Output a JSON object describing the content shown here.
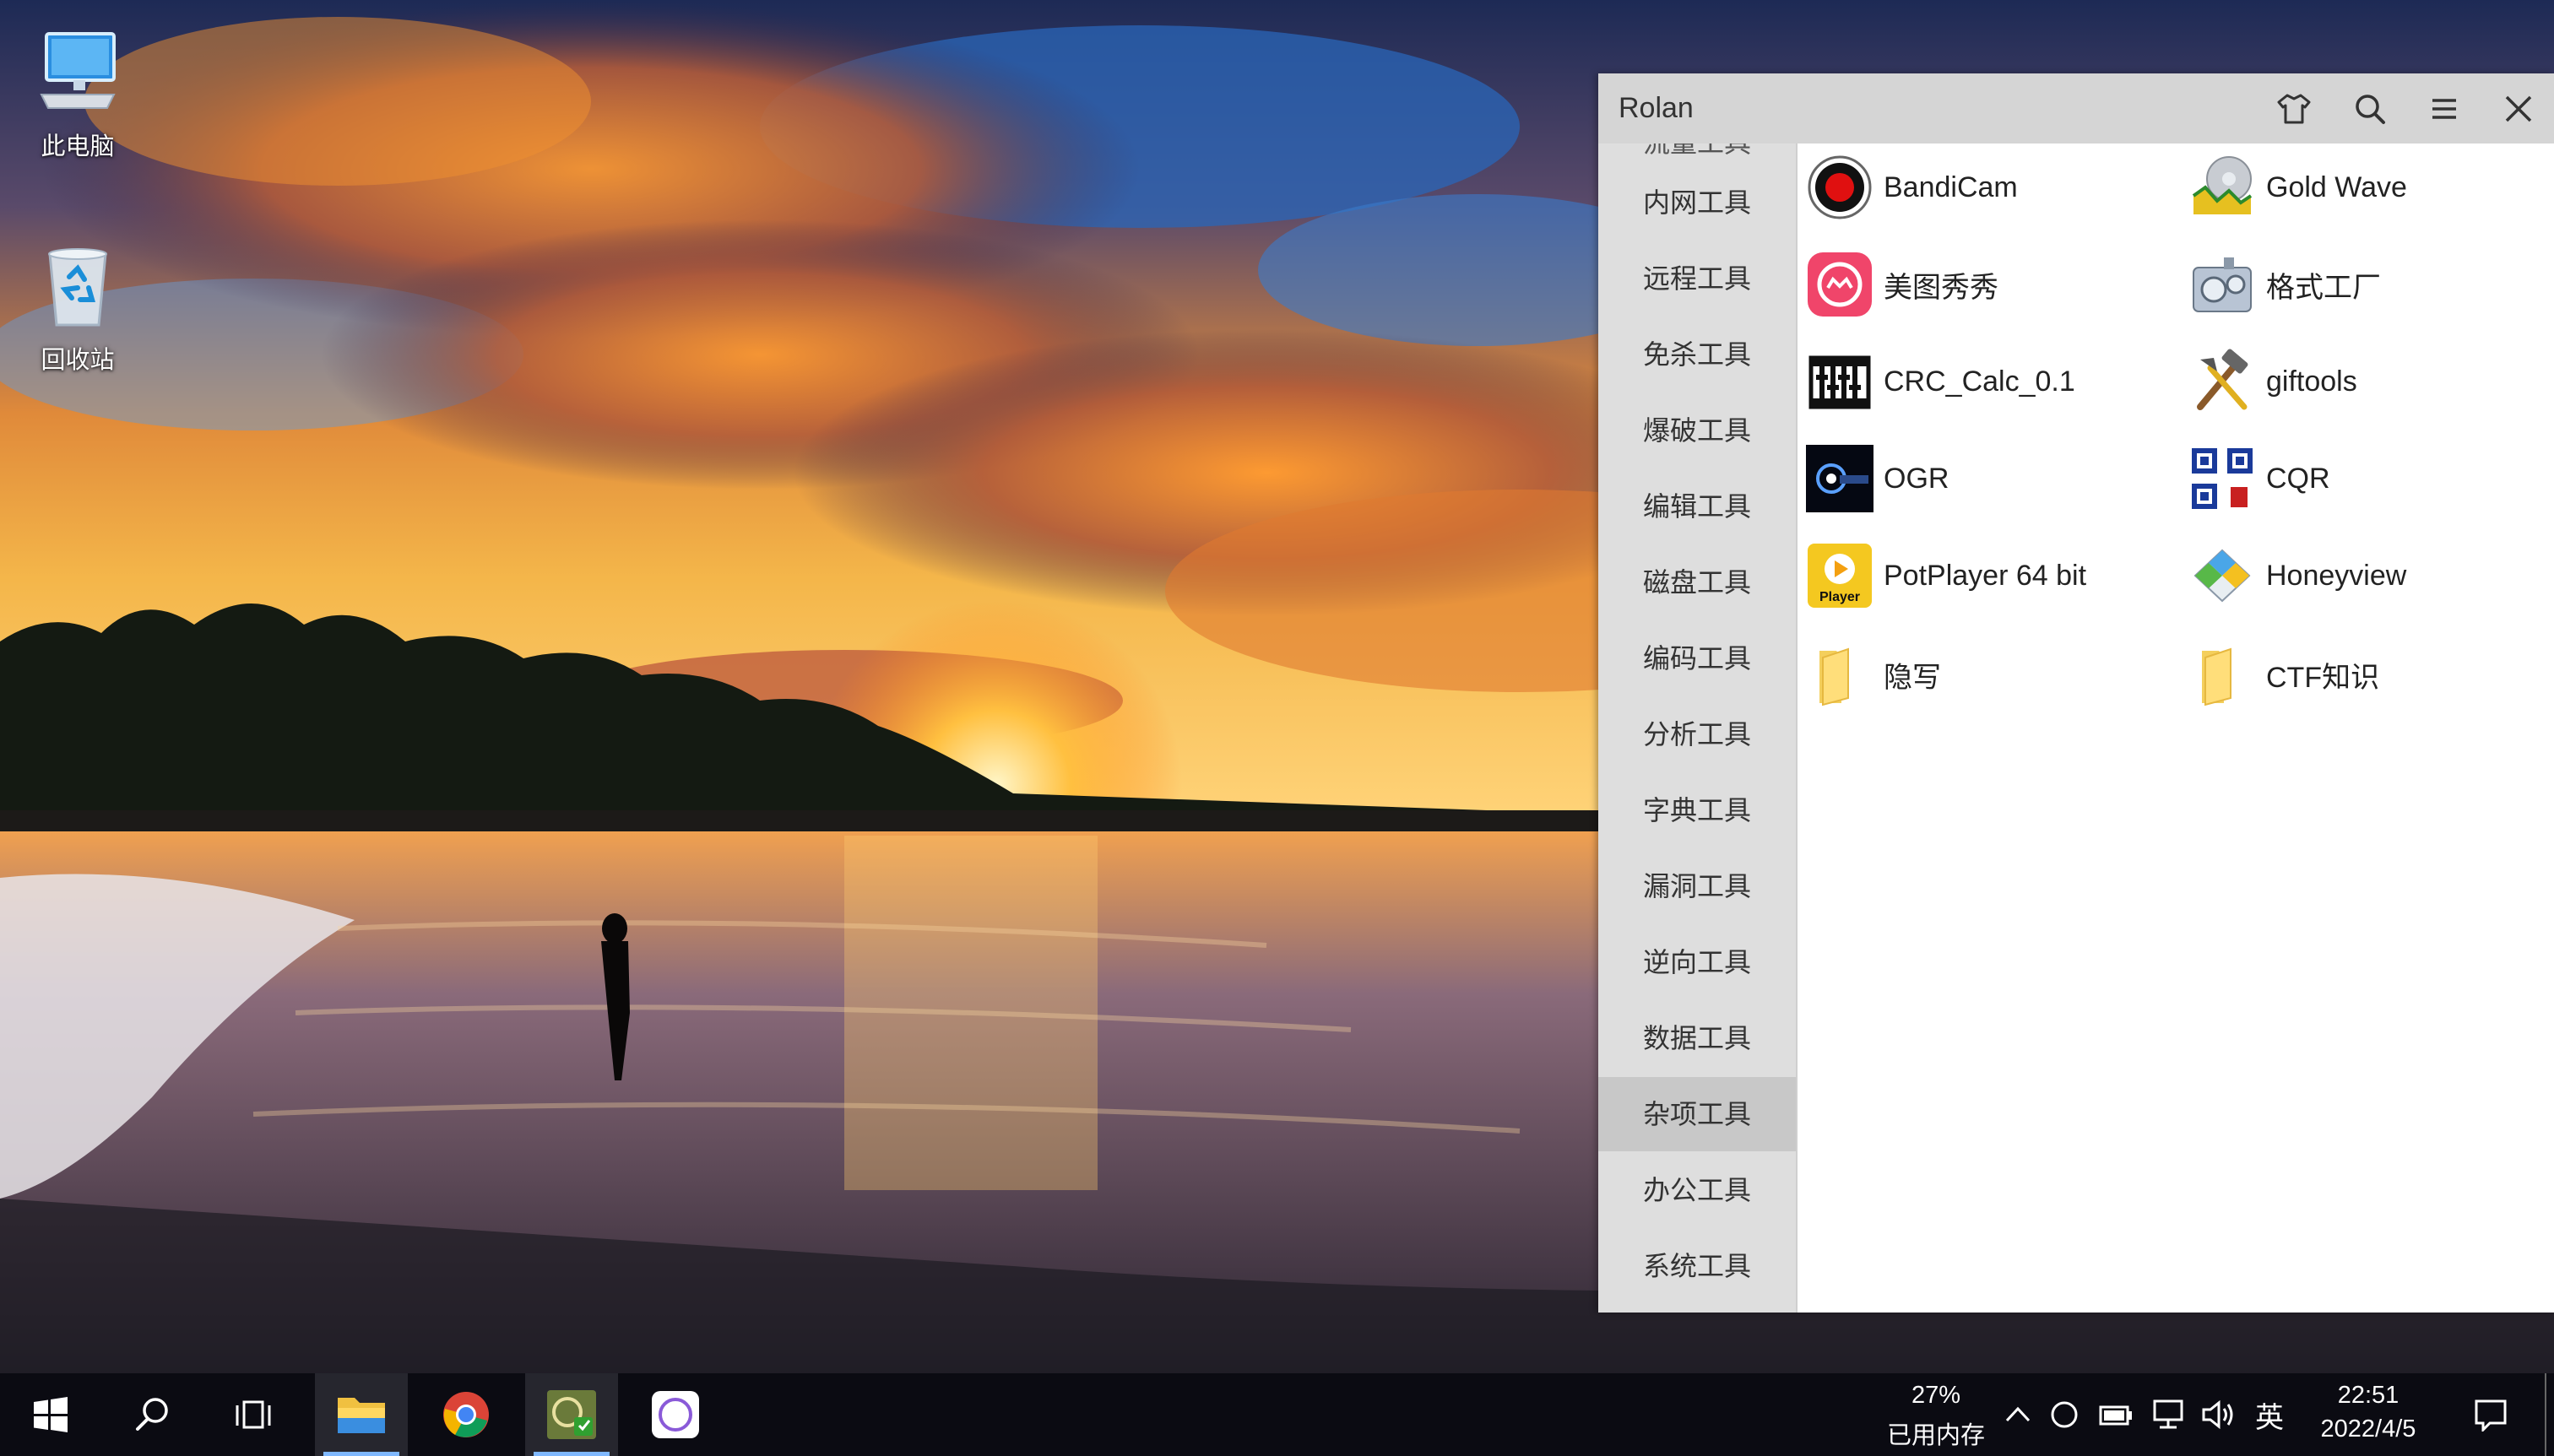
{
  "desktop": {
    "icons": [
      {
        "label": "此电脑",
        "icon": "computer-icon"
      },
      {
        "label": "回收站",
        "icon": "recycle-bin-icon"
      }
    ]
  },
  "window": {
    "title": "Rolan",
    "toolbar": [
      "skin-icon",
      "search-icon",
      "menu-icon",
      "close-icon"
    ],
    "sidebar_partial_top": "流量工具",
    "sidebar": [
      {
        "label": "内网工具"
      },
      {
        "label": "远程工具"
      },
      {
        "label": "免杀工具"
      },
      {
        "label": "爆破工具"
      },
      {
        "label": "编辑工具"
      },
      {
        "label": "磁盘工具"
      },
      {
        "label": "编码工具"
      },
      {
        "label": "分析工具"
      },
      {
        "label": "字典工具"
      },
      {
        "label": "漏洞工具"
      },
      {
        "label": "逆向工具"
      },
      {
        "label": "数据工具"
      },
      {
        "label": "杂项工具",
        "active": true
      },
      {
        "label": "办公工具"
      },
      {
        "label": "系统工具"
      }
    ],
    "apps": [
      {
        "name": "BandiCam",
        "icon": "bandicam-icon"
      },
      {
        "name": "Gold Wave",
        "icon": "goldwave-icon"
      },
      {
        "name": "美图秀秀",
        "icon": "meitu-icon"
      },
      {
        "name": "格式工厂",
        "icon": "format-factory-icon"
      },
      {
        "name": "CRC_Calc_0.1",
        "icon": "crc-calc-icon"
      },
      {
        "name": "giftools",
        "icon": "giftools-icon"
      },
      {
        "name": "OGR",
        "icon": "ogr-icon"
      },
      {
        "name": "CQR",
        "icon": "cqr-icon"
      },
      {
        "name": "PotPlayer 64 bit",
        "icon": "potplayer-icon"
      },
      {
        "name": "Honeyview",
        "icon": "honeyview-icon"
      },
      {
        "name": "隐写",
        "icon": "folder-icon"
      },
      {
        "name": "CTF知识",
        "icon": "folder-icon"
      }
    ],
    "potplayer_icon_text": "Player"
  },
  "taskbar": {
    "items": [
      "start-icon",
      "search-icon",
      "task-view-icon",
      "file-explorer-icon",
      "chrome-icon",
      "rolan-icon",
      "circle-app-icon"
    ],
    "memory_percent": "27%",
    "memory_label": "已用内存",
    "ime": "英",
    "time": "22:51",
    "date": "2022/4/5"
  },
  "colors": {
    "titlebar": "#d5d5d5",
    "sidebar": "#dedede",
    "sidebar_active": "#c8c8c8",
    "taskbar": "#0b0b12"
  }
}
